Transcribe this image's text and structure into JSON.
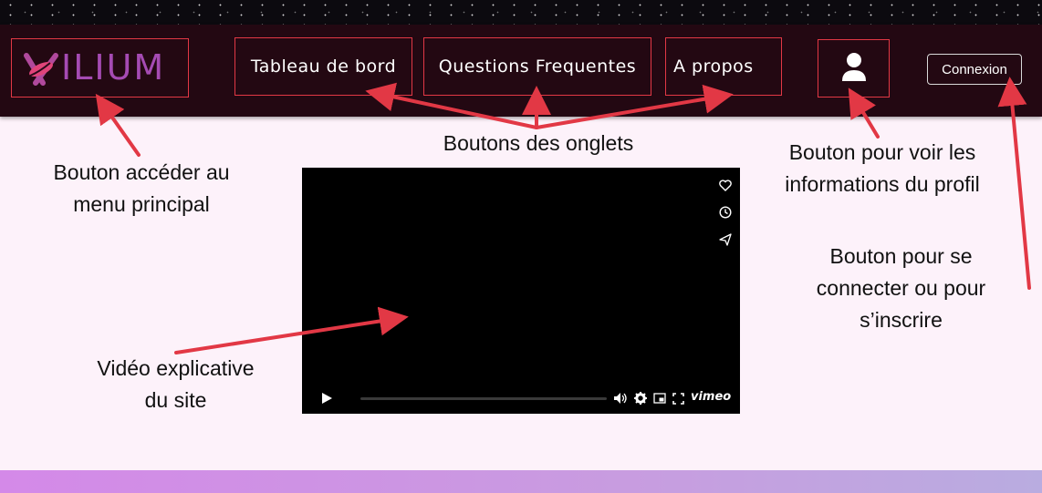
{
  "navbar": {
    "logo_text": "ILIUM",
    "tabs": [
      {
        "label": "Tableau de bord"
      },
      {
        "label": "Questions Frequentes"
      },
      {
        "label": "A propos"
      }
    ],
    "login_label": "Connexion"
  },
  "video": {
    "brand": "vimeo",
    "side_icons": [
      "heart-icon",
      "clock-icon",
      "send-icon"
    ],
    "control_icons": [
      "play-icon",
      "volume-icon",
      "settings-icon",
      "pip-icon",
      "fullscreen-icon"
    ]
  },
  "annotations": {
    "menu": "Bouton accéder au\nmenu principal",
    "tabs": "Boutons des onglets",
    "profile": "Bouton pour voir les\ninformations du profil",
    "login": "Bouton pour se\nconnecter ou pour\ns’inscrire",
    "video": "Vidéo explicative\ndu site"
  },
  "colors": {
    "navbar_bg": "#230812",
    "highlight_border": "#e23845",
    "arrow": "#e23845",
    "logo": "#a54bb3",
    "page_bg": "#fdf2fa"
  }
}
